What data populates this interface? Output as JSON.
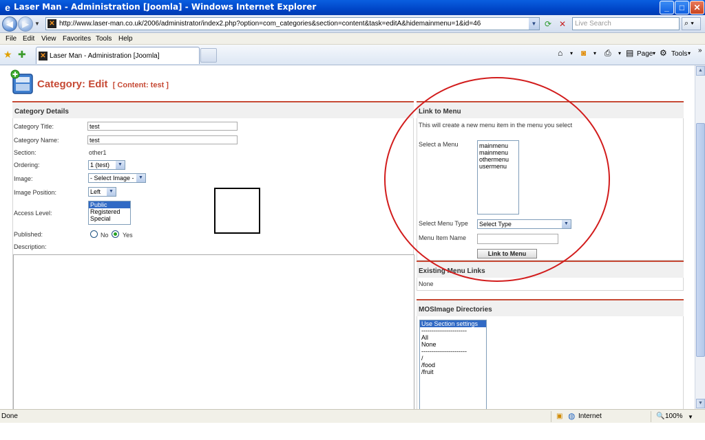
{
  "window": {
    "title": "Laser Man - Administration [Joomla] - Windows Internet Explorer",
    "minimize": "_",
    "maximize": "□",
    "close": "✕"
  },
  "address": {
    "url": "http://www.laser-man.co.uk/2006/administrator/index2.php?option=com_categories&section=content&task=editA&hidemainmenu=1&id=46",
    "search_placeholder": "Live Search"
  },
  "menu": [
    "File",
    "Edit",
    "View",
    "Favorites",
    "Tools",
    "Help"
  ],
  "tab": {
    "label": "Laser Man - Administration [Joomla]"
  },
  "toolbar_right": {
    "page": "Page",
    "tools": "Tools"
  },
  "page": {
    "title": "Category:",
    "title_action": "Edit",
    "subtitle": "[ Content: test ]"
  },
  "details": {
    "header": "Category Details",
    "title_label": "Category Title:",
    "title_value": "test",
    "name_label": "Category Name:",
    "name_value": "test",
    "section_label": "Section:",
    "section_value": "other1",
    "ordering_label": "Ordering:",
    "ordering_value": "1 (test)",
    "image_label": "Image:",
    "image_value": "- Select Image -",
    "image_position_label": "Image Position:",
    "image_position_value": "Left",
    "access_label": "Access Level:",
    "access_options": [
      "Public",
      "Registered",
      "Special"
    ],
    "access_selected": "Public",
    "published_label": "Published:",
    "published_no": "No",
    "published_yes": "Yes",
    "published_value": "Yes",
    "description_label": "Description:"
  },
  "link_menu": {
    "header": "Link to Menu",
    "info": "This will create a new menu item in the menu you select",
    "select_menu_label": "Select a Menu",
    "menus": [
      "mainmenu",
      "mainmenu",
      "othermenu",
      "usermenu"
    ],
    "menu_type_label": "Select Menu Type",
    "menu_type_value": "Select Type",
    "item_name_label": "Menu Item Name",
    "item_name_value": "",
    "button": "Link to Menu"
  },
  "existing_links": {
    "header": "Existing Menu Links",
    "value": "None"
  },
  "mosimage": {
    "header": "MOSImage Directories",
    "items": [
      "Use Section settings",
      "----------------------",
      "All",
      "None",
      "----------------------",
      "/",
      "/food",
      "/fruit"
    ],
    "selected": "Use Section settings"
  },
  "status": {
    "text": "Done",
    "zone": "Internet",
    "zoom": "100%"
  },
  "colors": {
    "accent": "#c64934",
    "annotation": "#d21c1c",
    "selection": "#316ac5"
  }
}
